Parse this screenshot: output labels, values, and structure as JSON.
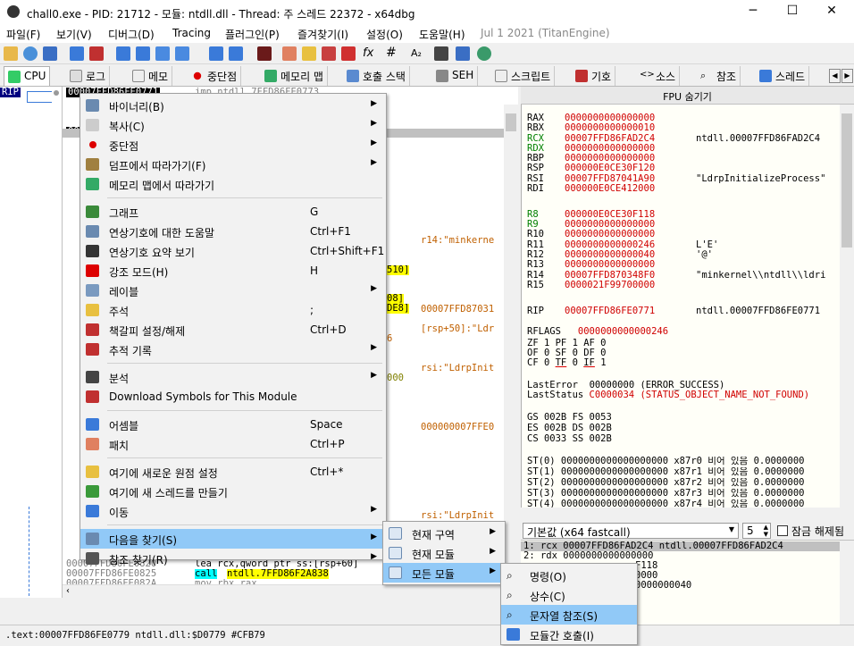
{
  "window": {
    "title": "chall0.exe - PID: 21712 - 모듈: ntdll.dll - Thread: 주 스레드 22372 - x64dbg",
    "minimize": "─",
    "maximize": "☐",
    "close": "✕"
  },
  "menubar": [
    "파일(F)",
    "보기(V)",
    "디버그(D)",
    "Tracing",
    "플러그인(P)",
    "즐겨찾기(I)",
    "설정(O)",
    "도움말(H)",
    "Jul 1 2021 (TitanEngine)"
  ],
  "tabs": [
    "CPU",
    "로그",
    "메모",
    "중단점",
    "메모리 맵",
    "호출 스택",
    "SEH",
    "스크립트",
    "기호",
    "소스",
    "참조",
    "스레드"
  ],
  "disasm": {
    "rip_label": "RIP",
    "first_addr": "00007FFD86FE0771",
    "first_instr": "jmp ntdll.7FFD86FE0773",
    "frag_addr": "00",
    "bottom_addr1": "00007FFD86FE0820",
    "bottom_instr1": "lea rcx,qword ptr ss:[rsp+60]",
    "bottom_addr2": "00007FFD86FE0825",
    "bottom_call_kw": "call",
    "bottom_call_target": "ntdll.7FFD86F2A838",
    "bottom_addr3": "00007FFD86FE082A",
    "bottom_instr3": "mov rbx,rax",
    "frag_510": "510]",
    "frag_08": "08]",
    "frag_de8": "DE8]",
    "frag_6": "6",
    "frag_000": "000",
    "comments": [
      "r14:\"minkerne",
      "00007FFD87031",
      "[rsp+50]:\"Ldr",
      "rsi:\"LdrpInit",
      "000000007FFE0",
      "rsi:\"LdrpInit"
    ]
  },
  "fpu_header": "FPU 숨기기",
  "registers": [
    {
      "name": "RAX",
      "value": "0000000000000000",
      "comment": "",
      "color": ""
    },
    {
      "name": "RBX",
      "value": "0000000000000010",
      "comment": "",
      "color": ""
    },
    {
      "name": "RCX",
      "value": "00007FFD86FAD2C4",
      "comment": "ntdll.00007FFD86FAD2C4",
      "color": "grn"
    },
    {
      "name": "RDX",
      "value": "0000000000000000",
      "comment": "",
      "color": "grn"
    },
    {
      "name": "RBP",
      "value": "0000000000000000",
      "comment": "",
      "color": ""
    },
    {
      "name": "RSP",
      "value": "000000E0CE30F120",
      "comment": "",
      "color": ""
    },
    {
      "name": "RSI",
      "value": "00007FFD87041A90",
      "comment": "\"LdrpInitializeProcess\"",
      "color": ""
    },
    {
      "name": "RDI",
      "value": "000000E0CE412000",
      "comment": "",
      "color": ""
    },
    {
      "name": "R8",
      "value": "000000E0CE30F118",
      "comment": "",
      "color": "grn"
    },
    {
      "name": "R9",
      "value": "0000000000000000",
      "comment": "",
      "color": "grn"
    },
    {
      "name": "R10",
      "value": "0000000000000000",
      "comment": "",
      "color": ""
    },
    {
      "name": "R11",
      "value": "0000000000000246",
      "comment": "L'Ȇ'",
      "color": ""
    },
    {
      "name": "R12",
      "value": "0000000000000040",
      "comment": "'@'",
      "color": ""
    },
    {
      "name": "R13",
      "value": "0000000000000000",
      "comment": "",
      "color": ""
    },
    {
      "name": "R14",
      "value": "00007FFD870348F0",
      "comment": "\"minkernel\\\\ntdll\\\\ldri",
      "color": ""
    },
    {
      "name": "R15",
      "value": "0000021F99700000",
      "comment": "",
      "color": ""
    },
    {
      "name": "RIP",
      "value": "00007FFD86FE0771",
      "comment": "ntdll.00007FFD86FE0771",
      "color": ""
    }
  ],
  "flags": {
    "rflags_label": "RFLAGS",
    "rflags": "0000000000000246",
    "row1": "ZF 1  PF 1  AF 0",
    "row2": "OF 0  SF 0  DF 0",
    "row3a": "CF 0  ",
    "row3b": "TF",
    "row3c": " 0  ",
    "row3d": "IF",
    "row3e": " 1"
  },
  "errors": {
    "lasterror_label": "LastError",
    "lasterror": "00000000 (ERROR_SUCCESS)",
    "laststatus_label": "LastStatus",
    "laststatus": "C0000034 (STATUS_OBJECT_NAME_NOT_FOUND)"
  },
  "segments": [
    "GS 002B  FS 0053",
    "ES 002B  DS 002B",
    "CS 0033  SS 002B"
  ],
  "st_regs": [
    "ST(0) 0000000000000000000 x87r0 비어 있음 0.0000000",
    "ST(1) 0000000000000000000 x87r1 비어 있음 0.0000000",
    "ST(2) 0000000000000000000 x87r2 비어 있음 0.0000000",
    "ST(3) 0000000000000000000 x87r3 비어 있음 0.0000000",
    "ST(4) 0000000000000000000 x87r4 비어 있음 0.0000000"
  ],
  "callconv": {
    "select": "기본값 (x64 fastcall)",
    "count": "5",
    "lock": "잠금 해제됨"
  },
  "stackargs": [
    "1: rcx 00007FFD86FAD2C4 ntdll.00007FFD86FAD2C4",
    "2: rdx 0000000000000000",
    "F118",
    "0000",
    "0000000040"
  ],
  "menu1": [
    {
      "label": "바이너리(B)",
      "sc": "",
      "sub": true
    },
    {
      "label": "복사(C)",
      "sc": "",
      "sub": true
    },
    {
      "label": "중단점",
      "sc": "",
      "sub": true
    },
    {
      "label": "덤프에서 따라가기(F)",
      "sc": "",
      "sub": true
    },
    {
      "label": "메모리 맵에서 따라가기",
      "sc": "",
      "sub": false
    },
    {
      "label": "그래프",
      "sc": "G",
      "sub": false
    },
    {
      "label": "연상기호에 대한 도움말",
      "sc": "Ctrl+F1",
      "sub": false
    },
    {
      "label": "연상기호 요약 보기",
      "sc": "Ctrl+Shift+F1",
      "sub": false
    },
    {
      "label": "강조 모드(H)",
      "sc": "H",
      "sub": false
    },
    {
      "label": "레이블",
      "sc": "",
      "sub": true
    },
    {
      "label": "주석",
      "sc": ";",
      "sub": false
    },
    {
      "label": "책갈피 설정/해제",
      "sc": "Ctrl+D",
      "sub": false
    },
    {
      "label": "추적 기록",
      "sc": "",
      "sub": true
    },
    {
      "label": "분석",
      "sc": "",
      "sub": true
    },
    {
      "label": "Download Symbols for This Module",
      "sc": "",
      "sub": false
    },
    {
      "label": "어셈블",
      "sc": "Space",
      "sub": false
    },
    {
      "label": "패치",
      "sc": "Ctrl+P",
      "sub": false
    },
    {
      "label": "여기에 새로운 원점 설정",
      "sc": "Ctrl+*",
      "sub": false
    },
    {
      "label": "여기에 새 스레드를 만들기",
      "sc": "",
      "sub": false
    },
    {
      "label": "이동",
      "sc": "",
      "sub": true
    },
    {
      "label": "다음을 찾기(S)",
      "sc": "",
      "sub": true
    },
    {
      "label": "참조 찾기(R)",
      "sc": "",
      "sub": true
    }
  ],
  "menu2": [
    "현재 구역",
    "현재 모듈",
    "모든 모듈"
  ],
  "menu3": [
    "명령(O)",
    "상수(C)",
    "문자열 참조(S)",
    "모듈간 호출(I)"
  ],
  "status": ".text:00007FFD86FE0779 ntdll.dll:$D0779 #CFB79",
  "colors": {
    "highlight": "#91c9f7",
    "rip_bg": "#000080",
    "yellow": "#ffff00",
    "red": "#d00000",
    "green": "#008000"
  }
}
